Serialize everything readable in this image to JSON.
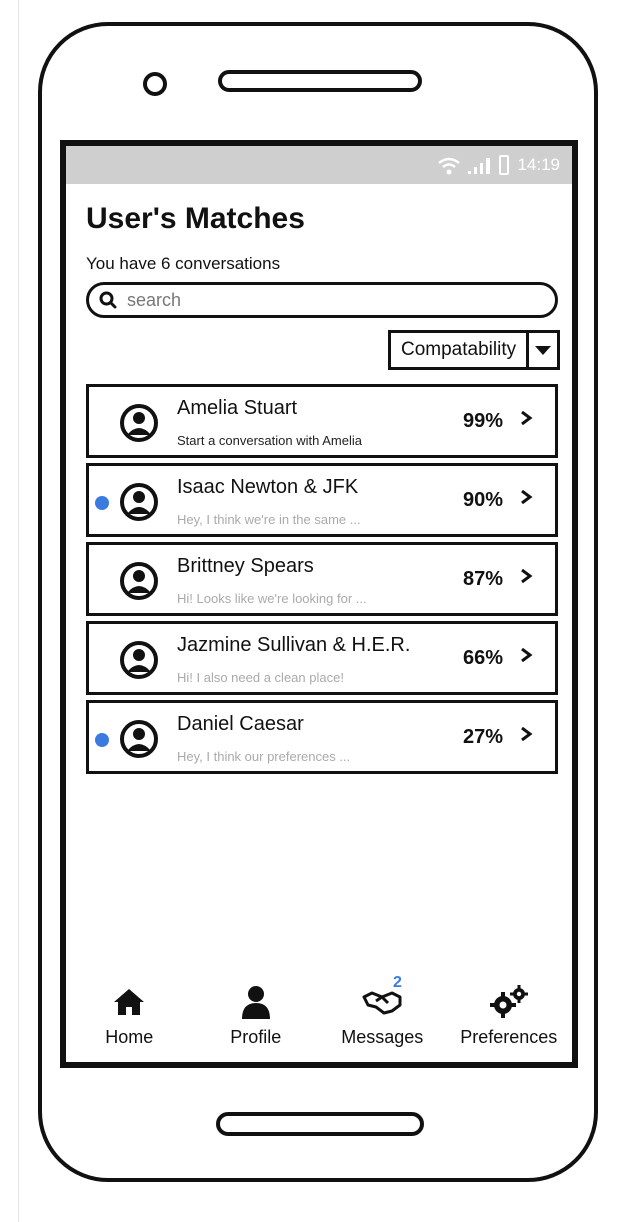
{
  "status_bar": {
    "time": "14:19"
  },
  "header": {
    "title": "User's Matches",
    "subtitle": "You have 6 conversations"
  },
  "search": {
    "placeholder": "search"
  },
  "sort": {
    "selected": "Compatability"
  },
  "matches": [
    {
      "name": "Amelia Stuart",
      "preview": "Start a conversation with Amelia",
      "percent": "99%",
      "unread": false
    },
    {
      "name": "Isaac Newton & JFK",
      "preview": "Hey, I think we're in the same ...",
      "percent": "90%",
      "unread": true
    },
    {
      "name": "Brittney Spears",
      "preview": "Hi! Looks like we're looking for ...",
      "percent": "87%",
      "unread": false
    },
    {
      "name": "Jazmine Sullivan & H.E.R.",
      "preview": "Hi! I also need a clean place!",
      "percent": "66%",
      "unread": false
    },
    {
      "name": "Daniel Caesar",
      "preview": "Hey, I think our preferences ...",
      "percent": "27%",
      "unread": true
    }
  ],
  "nav": {
    "home_label": "Home",
    "profile_label": "Profile",
    "messages_label": "Messages",
    "messages_badge": "2",
    "preferences_label": "Preferences"
  },
  "colors": {
    "accent": "#3b7be0",
    "statusbar": "#cfcfcf"
  }
}
